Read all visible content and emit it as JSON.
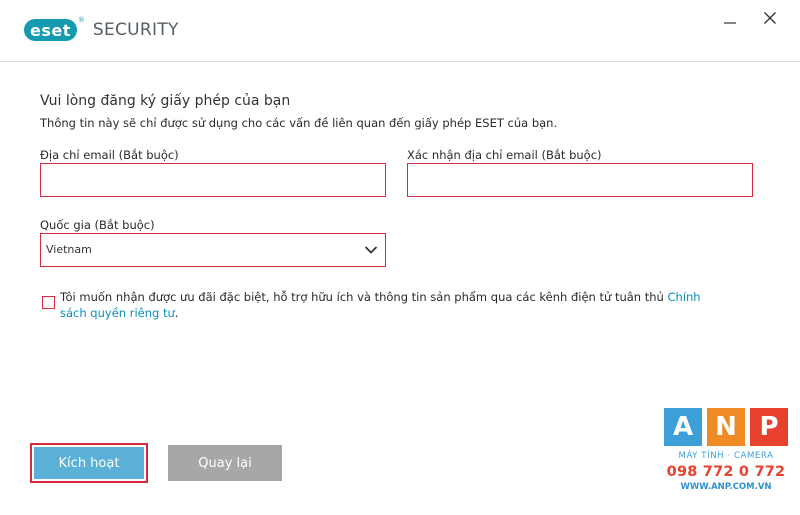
{
  "window": {
    "logo_text": "eset",
    "brand_word": "SECURITY",
    "registered_mark": "®",
    "minimize_icon": "minimize-icon",
    "close_icon": "close-icon"
  },
  "form": {
    "heading": "Vui lòng đăng ký giấy phép của bạn",
    "subheading": "Thông tin này sẽ chỉ được sử dụng cho các vấn đề liên quan đến giấy phép ESET của bạn.",
    "email": {
      "label": "Địa chỉ email (Bắt buộc)",
      "value": "",
      "placeholder": ""
    },
    "confirm_email": {
      "label": "Xác nhận địa chỉ email (Bắt buộc)",
      "value": "",
      "placeholder": ""
    },
    "country": {
      "label": "Quốc gia (Bắt buộc)",
      "selected": "Vietnam",
      "icon": "chevron-down-icon"
    },
    "consent": {
      "checked": false,
      "text": "Tôi muốn nhận được ưu đãi đặc biệt, hỗ trợ hữu ích và thông tin sản phẩm qua các kênh điện tử tuân thủ ",
      "link": "Chính sách quyền riêng tư",
      "suffix": "."
    }
  },
  "buttons": {
    "activate": "Kích hoạt",
    "back": "Quay lại"
  },
  "watermark": {
    "tiles": [
      {
        "letter": "A",
        "color": "#3c9fd8"
      },
      {
        "letter": "N",
        "color": "#f08a25"
      },
      {
        "letter": "P",
        "color": "#e8412e"
      }
    ],
    "tagline": "MÁY TÍNH · CAMERA",
    "phone": "098 772 0 772",
    "url": "WWW.ANP.COM.VN"
  },
  "colors": {
    "accent": "#169aad",
    "error_border": "#d72a3e",
    "primary_button": "#5ab0d7",
    "secondary_button": "#a7a7a7",
    "link": "#0d8fb8"
  }
}
